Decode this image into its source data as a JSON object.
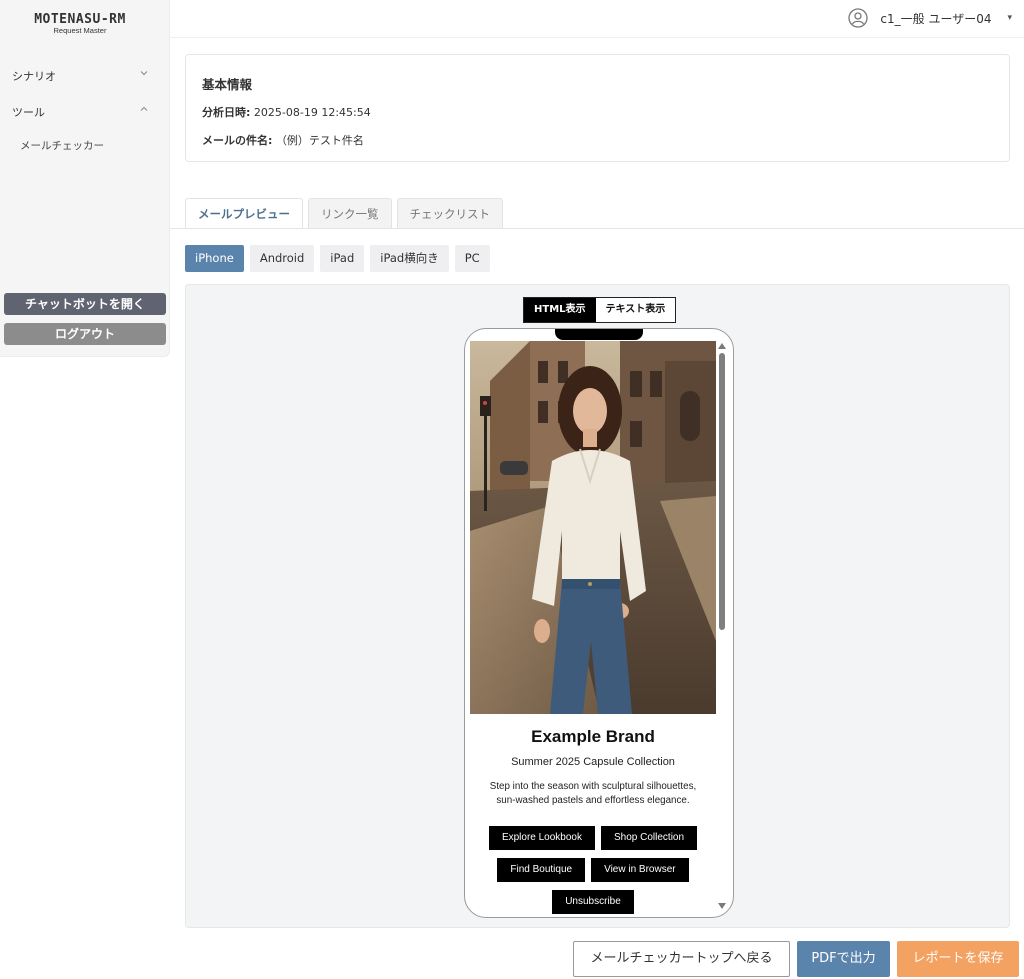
{
  "logo": {
    "main": "MOTENASU-RM",
    "sub": "Request Master"
  },
  "sidebar": {
    "items": [
      {
        "label": "シナリオ",
        "expanded": false
      },
      {
        "label": "ツール",
        "expanded": true,
        "children": [
          {
            "label": "メールチェッカー"
          }
        ]
      }
    ],
    "chatbot_label": "チャットボットを開く",
    "logout_label": "ログアウト"
  },
  "header": {
    "user_name": "c1_一般 ユーザー04",
    "user_icon": "user-circle-icon"
  },
  "info": {
    "title": "基本情報",
    "analysis_label": "分析日時:",
    "analysis_value": "2025-08-19 12:45:54",
    "subject_label": "メールの件名:",
    "subject_value": "（例）テスト件名"
  },
  "tabs": [
    {
      "label": "メールプレビュー",
      "active": true
    },
    {
      "label": "リンク一覧",
      "active": false
    },
    {
      "label": "チェックリスト",
      "active": false
    }
  ],
  "devices": [
    {
      "label": "iPhone",
      "active": true
    },
    {
      "label": "Android",
      "active": false
    },
    {
      "label": "iPad",
      "active": false
    },
    {
      "label": "iPad横向き",
      "active": false
    },
    {
      "label": "PC",
      "active": false
    }
  ],
  "view_toggle": {
    "html_label": "HTML表示",
    "text_label": "テキスト表示",
    "selected": "HTML表示"
  },
  "email": {
    "brand": "Example Brand",
    "subtitle": "Summer 2025 Capsule Collection",
    "description": "Step into the season with sculptural silhouettes, sun-washed pastels and effortless elegance.",
    "buttons": [
      "Explore Lookbook",
      "Shop Collection",
      "Find Boutique",
      "View in Browser",
      "Unsubscribe"
    ]
  },
  "footer": {
    "back_label": "メールチェッカートップへ戻る",
    "pdf_label": "PDFで出力",
    "save_label": "レポートを保存"
  },
  "colors": {
    "accent": "#5b84ad",
    "save": "#f4a262",
    "chat_button": "#5f6470",
    "logout_button": "#8c8c8c"
  }
}
